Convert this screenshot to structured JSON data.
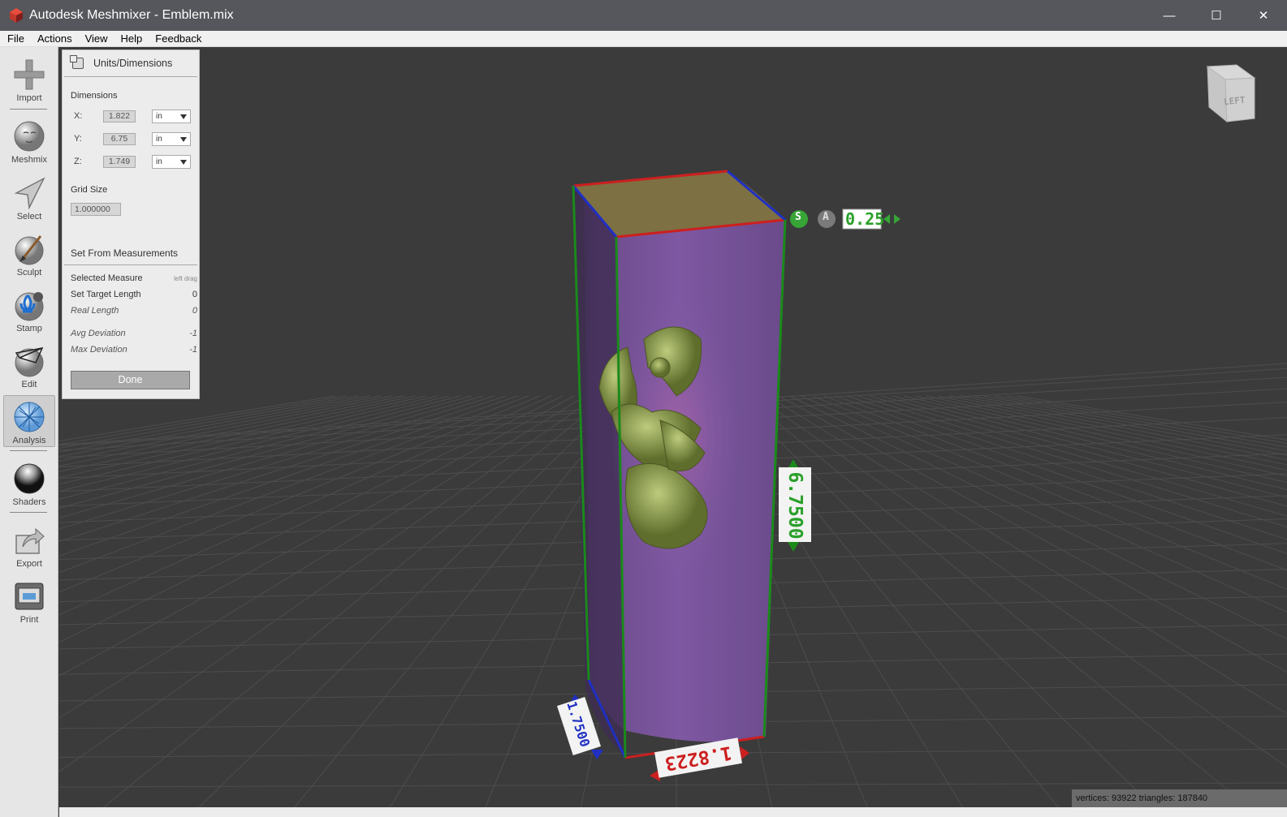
{
  "window": {
    "title": "Autodesk Meshmixer - Emblem.mix",
    "minimize_glyph": "—",
    "maximize_glyph": "☐",
    "close_glyph": "✕"
  },
  "menu": [
    "File",
    "Actions",
    "View",
    "Help",
    "Feedback"
  ],
  "toolbar": {
    "tools": [
      {
        "label": "Import",
        "icon": "plus-icon"
      },
      {
        "label": "Meshmix",
        "icon": "face-sphere-icon"
      },
      {
        "label": "Select",
        "icon": "arrow-cursor-icon"
      },
      {
        "label": "Sculpt",
        "icon": "brush-icon"
      },
      {
        "label": "Stamp",
        "icon": "fleur-de-lis-icon"
      },
      {
        "label": "Edit",
        "icon": "wireframe-sphere-icon"
      },
      {
        "label": "Analysis",
        "icon": "mesh-sphere-icon",
        "active": true
      },
      {
        "label": "Shaders",
        "icon": "chrome-sphere-icon"
      },
      {
        "label": "Export",
        "icon": "export-arrow-icon"
      },
      {
        "label": "Print",
        "icon": "printer-icon"
      }
    ]
  },
  "panel": {
    "title": "Units/Dimensions",
    "dimensions_label": "Dimensions",
    "dims": [
      {
        "axis": "X:",
        "value": "1.822",
        "unit": "in"
      },
      {
        "axis": "Y:",
        "value": "6.75",
        "unit": "in"
      },
      {
        "axis": "Z:",
        "value": "1.749",
        "unit": "in"
      }
    ],
    "grid_size_label": "Grid Size",
    "grid_size_value": "1.000000",
    "set_from_measurements": "Set From Measurements",
    "selected_measure": {
      "label": "Selected Measure",
      "hint": "left drag"
    },
    "set_target_length": {
      "label": "Set Target Length",
      "value": "0"
    },
    "real_length": {
      "label": "Real Length",
      "value": "0"
    },
    "avg_deviation": {
      "label": "Avg Deviation",
      "value": "-1"
    },
    "max_deviation": {
      "label": "Max Deviation",
      "value": "-1"
    },
    "done_label": "Done"
  },
  "viewport": {
    "view_cube_label": "LEFT",
    "snap_s": "S",
    "snap_a": "A",
    "snap_value": "0.25",
    "dim_x": "1.8223",
    "dim_y": "6.7500",
    "dim_z": "1.7500",
    "colors": {
      "x": "#cc1f1f",
      "y": "#1a8a1a",
      "z": "#1f2fc4",
      "object": "#7d4f9a",
      "emblem": "#8d9a4e"
    }
  },
  "status": "vertices: 93922 triangles: 187840"
}
